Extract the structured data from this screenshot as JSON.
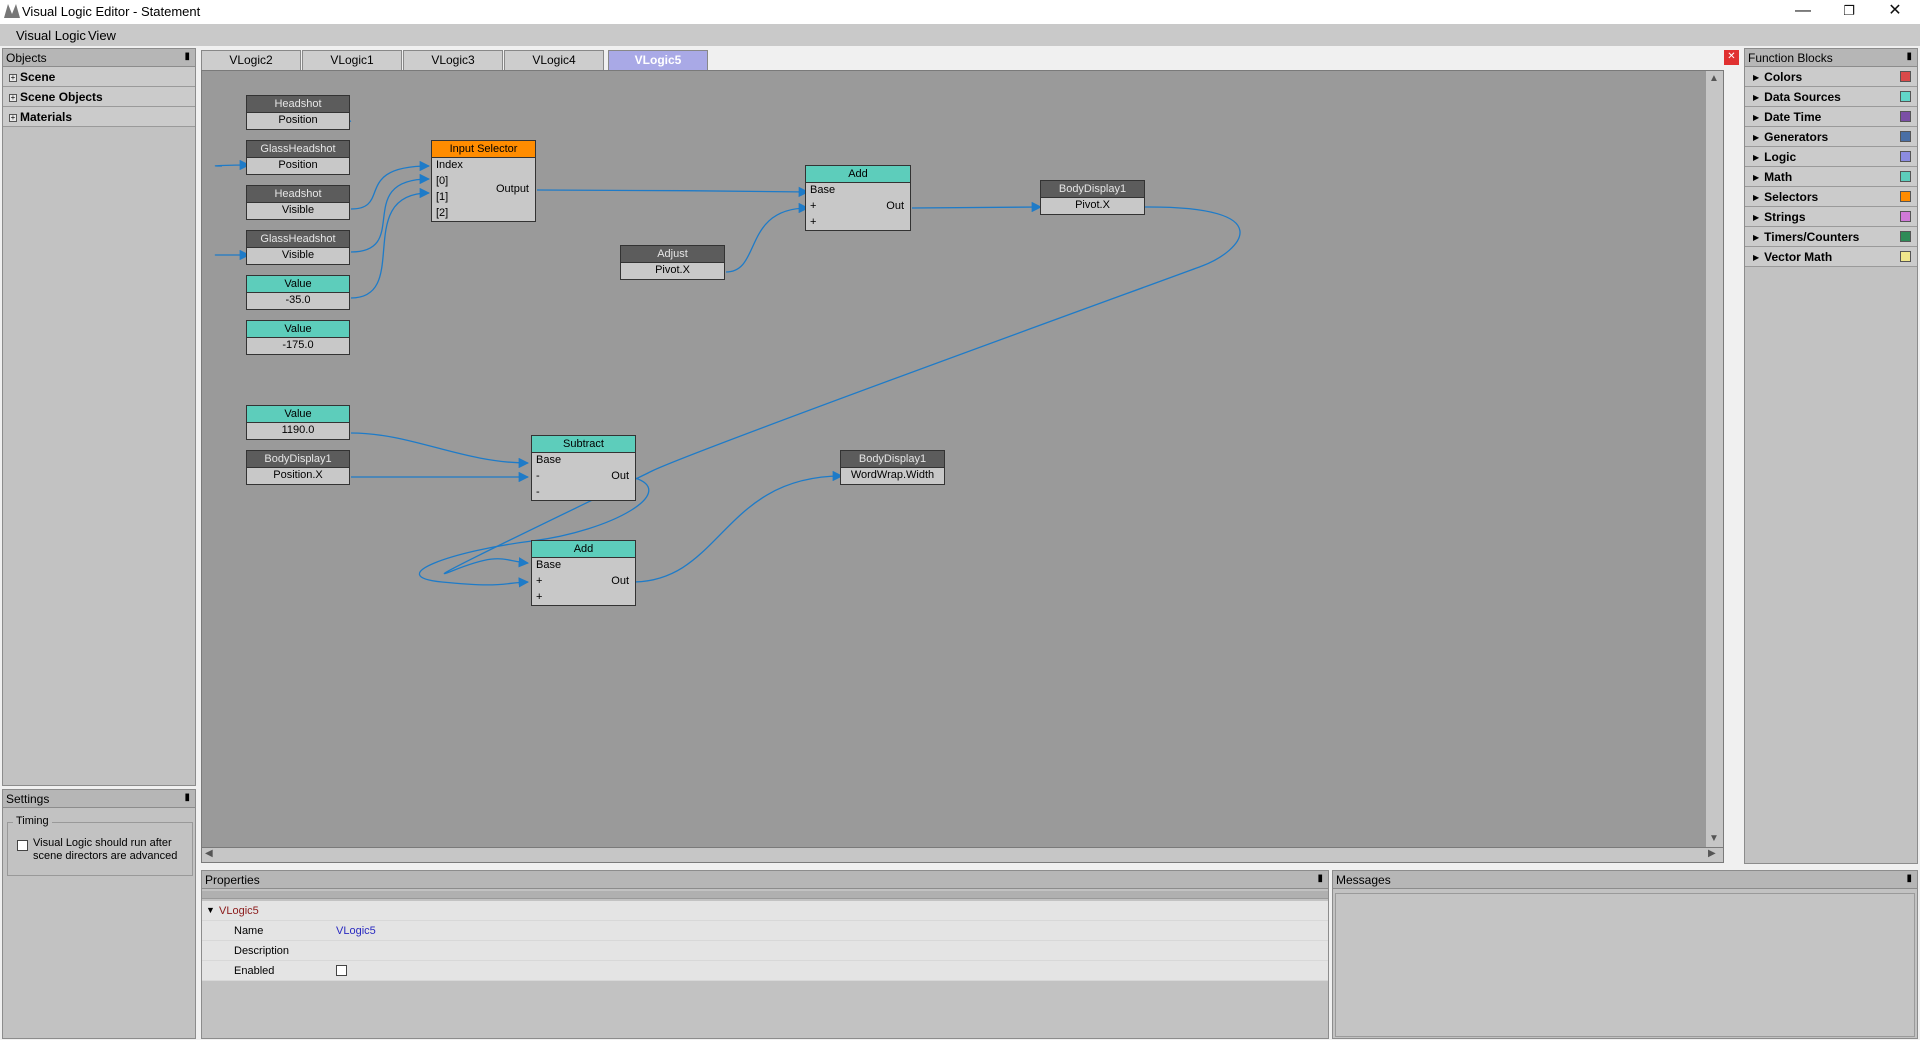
{
  "window": {
    "title": "Visual Logic Editor - Statement"
  },
  "menu": [
    "Visual Logic",
    "View"
  ],
  "objects_panel": {
    "title": "Objects",
    "items": [
      {
        "label": "Scene"
      },
      {
        "label": "Scene Objects"
      },
      {
        "label": "Materials"
      }
    ]
  },
  "settings_panel": {
    "title": "Settings",
    "group": "Timing",
    "checkbox_line1": "Visual Logic should run after",
    "checkbox_line2": "scene directors are advanced",
    "checked": false
  },
  "tabs": [
    {
      "label": "VLogic2"
    },
    {
      "label": "VLogic1"
    },
    {
      "label": "VLogic3"
    },
    {
      "label": "VLogic4"
    },
    {
      "label": "VLogic5",
      "active": true
    }
  ],
  "nodes": {
    "n1": {
      "title": "Headshot",
      "port": "Position"
    },
    "n2": {
      "title": "GlassHeadshot",
      "port": "Position"
    },
    "n3": {
      "title": "Headshot",
      "port": "Visible"
    },
    "n4": {
      "title": "GlassHeadshot",
      "port": "Visible"
    },
    "v1": {
      "title": "Value",
      "value": "-35.0"
    },
    "v2": {
      "title": "Value",
      "value": "-175.0"
    },
    "sel": {
      "title": "Input Selector",
      "ports": [
        "Index",
        "[0]",
        "[1]",
        "[2]"
      ],
      "out": "Output"
    },
    "adj": {
      "title": "Adjust",
      "port": "Pivot.X"
    },
    "add1": {
      "title": "Add",
      "ports": [
        "Base",
        "+",
        "+"
      ],
      "out": "Out"
    },
    "bd1": {
      "title": "BodyDisplay1",
      "port": "Pivot.X"
    },
    "v3": {
      "title": "Value",
      "value": "1190.0"
    },
    "bd2": {
      "title": "BodyDisplay1",
      "port": "Position.X"
    },
    "sub": {
      "title": "Subtract",
      "ports": [
        "Base",
        "-",
        "-"
      ],
      "out": "Out"
    },
    "bd3": {
      "title": "BodyDisplay1",
      "port": "WordWrap.Width"
    },
    "add2": {
      "title": "Add",
      "ports": [
        "Base",
        "+",
        "+"
      ],
      "out": "Out"
    }
  },
  "function_blocks": {
    "title": "Function Blocks",
    "items": [
      {
        "label": "Colors",
        "color": "#d94a4a"
      },
      {
        "label": "Data Sources",
        "color": "#62d6c8"
      },
      {
        "label": "Date Time",
        "color": "#7b4fa6"
      },
      {
        "label": "Generators",
        "color": "#4a6fa5"
      },
      {
        "label": "Logic",
        "color": "#8c8ce0"
      },
      {
        "label": "Math",
        "color": "#5dcdbb"
      },
      {
        "label": "Selectors",
        "color": "#ff8c00"
      },
      {
        "label": "Strings",
        "color": "#d07ad8"
      },
      {
        "label": "Timers/Counters",
        "color": "#2e8b57"
      },
      {
        "label": "Vector Math",
        "color": "#f0e68c"
      }
    ]
  },
  "properties": {
    "title": "Properties",
    "section": "VLogic5",
    "name_label": "Name",
    "name_value": "VLogic5",
    "description_label": "Description",
    "enabled_label": "Enabled"
  },
  "messages": {
    "title": "Messages"
  }
}
